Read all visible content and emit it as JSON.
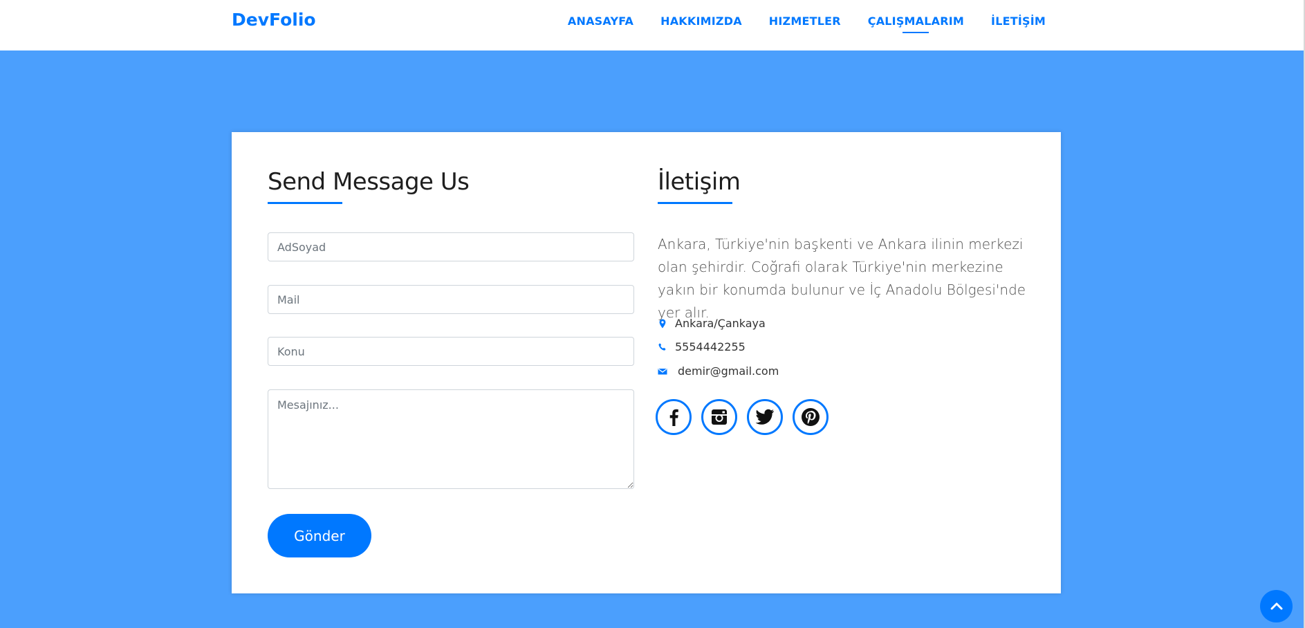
{
  "header": {
    "brand": "DevFolio",
    "nav": [
      {
        "label": "ANASAYFA",
        "active": false
      },
      {
        "label": "HAKKIMIZDA",
        "active": false
      },
      {
        "label": "HIZMETLER",
        "active": false
      },
      {
        "label": "ÇALIŞMALARIM",
        "active": true
      },
      {
        "label": "İLETİŞİM",
        "active": false
      }
    ]
  },
  "form": {
    "title": "Send Message Us",
    "name_placeholder": "AdSoyad",
    "mail_placeholder": "Mail",
    "subject_placeholder": "Konu",
    "message_placeholder": "Mesajınız...",
    "submit_label": "Gönder"
  },
  "contact": {
    "title": "İletişim",
    "description": "Ankara, Türkiye'nin başkenti ve Ankara ilinin merkezi olan şehirdir. Coğrafi olarak Türkiye'nin merkezine yakın bir konumda bulunur ve İç Anadolu Bölgesi'nde yer alır.",
    "address": "Ankara/Çankaya",
    "phone": "5554442255",
    "email": "demir@gmail.com",
    "socials": [
      "facebook-icon",
      "instagram-icon",
      "twitter-icon",
      "pinterest-icon"
    ]
  },
  "colors": {
    "accent": "#0078ff",
    "background": "#4b9ffd"
  },
  "icons": {
    "back_to_top": "chevron-up-icon",
    "address": "map-marker-icon",
    "phone": "phone-icon",
    "email": "envelope-icon"
  }
}
